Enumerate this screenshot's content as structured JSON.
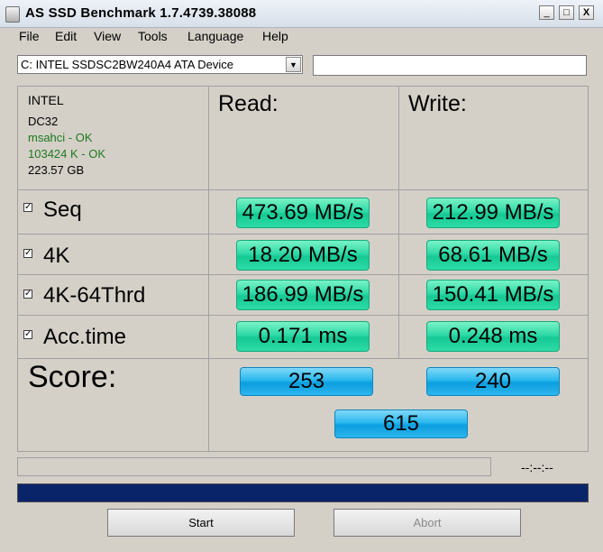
{
  "window": {
    "title": "AS SSD Benchmark 1.7.4739.38088",
    "controls": {
      "minimize": "_",
      "maximize": "□",
      "close": "X"
    }
  },
  "menu": [
    "File",
    "Edit",
    "View",
    "Tools",
    "Language",
    "Help"
  ],
  "drive_select": {
    "selected": "C: INTEL SSDSC2BW240A4 ATA Device",
    "arrow": "▼"
  },
  "info": {
    "vendor": "INTEL",
    "firmware": "DC32",
    "driver": "msahci - OK",
    "alignment": "103424 K - OK",
    "size": "223.57 GB"
  },
  "headers": {
    "read": "Read:",
    "write": "Write:"
  },
  "rows": [
    {
      "checked": "✓",
      "label": "Seq",
      "read": "473.69 MB/s",
      "write": "212.99 MB/s"
    },
    {
      "checked": "✓",
      "label": "4K",
      "read": "18.20 MB/s",
      "write": "68.61 MB/s"
    },
    {
      "checked": "✓",
      "label": "4K-64Thrd",
      "read": "186.99 MB/s",
      "write": "150.41 MB/s"
    },
    {
      "checked": "✓",
      "label": "Acc.time",
      "read": "0.171 ms",
      "write": "0.248 ms"
    }
  ],
  "score": {
    "label": "Score:",
    "read": "253",
    "write": "240",
    "total": "615"
  },
  "status": {
    "time": "--:--:--"
  },
  "buttons": {
    "start": "Start",
    "abort": "Abort"
  },
  "colors": {
    "value_box": "#2ed9a6",
    "score_box": "#2ab8ee",
    "progress": "#0a246a",
    "ok_text": "#1e7a1e"
  }
}
